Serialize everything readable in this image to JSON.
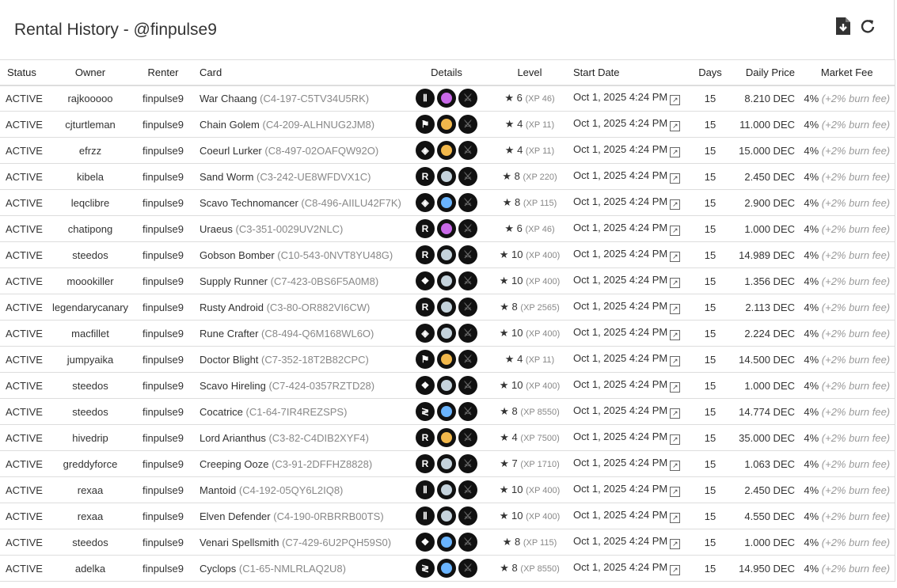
{
  "header": {
    "title": "Rental History - @finpulse9",
    "download_icon": "file-download-icon",
    "refresh_icon": "refresh-icon"
  },
  "columns": [
    "Status",
    "Owner",
    "Renter",
    "Card",
    "Details",
    "Level",
    "Start Date",
    "Days",
    "Daily Price",
    "Market Fee"
  ],
  "rarity_colors": {
    "common": "#c5d3dc",
    "rare": "#6ab4ff",
    "epic": "#c969e8",
    "legendary": "#f2b84b"
  },
  "rows": [
    {
      "status": "ACTIVE",
      "owner": "rajkooooo",
      "renter": "finpulse9",
      "card": "War Chaang",
      "uid": "(C4-197-C5TV34U5RK)",
      "edition": "Ⅱ",
      "rarity": "epic",
      "level": "6",
      "xp": "(XP 46)",
      "date": "Oct 1, 2025 4:24 PM",
      "days": "15",
      "price": "8.210 DEC",
      "fee": "4%",
      "burn": "(+2% burn fee)"
    },
    {
      "status": "ACTIVE",
      "owner": "cjturtleman",
      "renter": "finpulse9",
      "card": "Chain Golem",
      "uid": "(C4-209-ALHNUG2JM8)",
      "edition": "⚑",
      "rarity": "legendary",
      "level": "4",
      "xp": "(XP 11)",
      "date": "Oct 1, 2025 4:24 PM",
      "days": "15",
      "price": "11.000 DEC",
      "fee": "4%",
      "burn": "(+2% burn fee)"
    },
    {
      "status": "ACTIVE",
      "owner": "efrzz",
      "renter": "finpulse9",
      "card": "Coeurl Lurker",
      "uid": "(C8-497-02OAFQW92O)",
      "edition": "◈",
      "rarity": "legendary",
      "level": "4",
      "xp": "(XP 11)",
      "date": "Oct 1, 2025 4:24 PM",
      "days": "15",
      "price": "15.000 DEC",
      "fee": "4%",
      "burn": "(+2% burn fee)"
    },
    {
      "status": "ACTIVE",
      "owner": "kibela",
      "renter": "finpulse9",
      "card": "Sand Worm",
      "uid": "(C3-242-UE8WFDVX1C)",
      "edition": "R",
      "rarity": "common",
      "level": "8",
      "xp": "(XP 220)",
      "date": "Oct 1, 2025 4:24 PM",
      "days": "15",
      "price": "2.450 DEC",
      "fee": "4%",
      "burn": "(+2% burn fee)"
    },
    {
      "status": "ACTIVE",
      "owner": "leqclibre",
      "renter": "finpulse9",
      "card": "Scavo Technomancer",
      "uid": "(C8-496-AIILU42F7K)",
      "edition": "◈",
      "rarity": "rare",
      "level": "8",
      "xp": "(XP 115)",
      "date": "Oct 1, 2025 4:24 PM",
      "days": "15",
      "price": "2.900 DEC",
      "fee": "4%",
      "burn": "(+2% burn fee)"
    },
    {
      "status": "ACTIVE",
      "owner": "chatipong",
      "renter": "finpulse9",
      "card": "Uraeus",
      "uid": "(C3-351-0029UV2NLC)",
      "edition": "R",
      "rarity": "epic",
      "level": "6",
      "xp": "(XP 46)",
      "date": "Oct 1, 2025 4:24 PM",
      "days": "15",
      "price": "1.000 DEC",
      "fee": "4%",
      "burn": "(+2% burn fee)"
    },
    {
      "status": "ACTIVE",
      "owner": "steedos",
      "renter": "finpulse9",
      "card": "Gobson Bomber",
      "uid": "(C10-543-0NVT8YU48G)",
      "edition": "R",
      "rarity": "common",
      "level": "10",
      "xp": "(XP 400)",
      "date": "Oct 1, 2025 4:24 PM",
      "days": "15",
      "price": "14.989 DEC",
      "fee": "4%",
      "burn": "(+2% burn fee)"
    },
    {
      "status": "ACTIVE",
      "owner": "moookiller",
      "renter": "finpulse9",
      "card": "Supply Runner",
      "uid": "(C7-423-0BS6F5A0M8)",
      "edition": "❖",
      "rarity": "common",
      "level": "10",
      "xp": "(XP 400)",
      "date": "Oct 1, 2025 4:24 PM",
      "days": "15",
      "price": "1.356 DEC",
      "fee": "4%",
      "burn": "(+2% burn fee)"
    },
    {
      "status": "ACTIVE",
      "owner": "legendarycanary",
      "renter": "finpulse9",
      "card": "Rusty Android",
      "uid": "(C3-80-OR882VI6CW)",
      "edition": "R",
      "rarity": "common",
      "level": "8",
      "xp": "(XP 2565)",
      "date": "Oct 1, 2025 4:24 PM",
      "days": "15",
      "price": "2.113 DEC",
      "fee": "4%",
      "burn": "(+2% burn fee)"
    },
    {
      "status": "ACTIVE",
      "owner": "macfillet",
      "renter": "finpulse9",
      "card": "Rune Crafter",
      "uid": "(C8-494-Q6M168WL6O)",
      "edition": "◈",
      "rarity": "common",
      "level": "10",
      "xp": "(XP 400)",
      "date": "Oct 1, 2025 4:24 PM",
      "days": "15",
      "price": "2.224 DEC",
      "fee": "4%",
      "burn": "(+2% burn fee)"
    },
    {
      "status": "ACTIVE",
      "owner": "jumpyaika",
      "renter": "finpulse9",
      "card": "Doctor Blight",
      "uid": "(C7-352-18T2B82CPC)",
      "edition": "⚑",
      "rarity": "legendary",
      "level": "4",
      "xp": "(XP 11)",
      "date": "Oct 1, 2025 4:24 PM",
      "days": "15",
      "price": "14.500 DEC",
      "fee": "4%",
      "burn": "(+2% burn fee)"
    },
    {
      "status": "ACTIVE",
      "owner": "steedos",
      "renter": "finpulse9",
      "card": "Scavo Hireling",
      "uid": "(C7-424-0357RZTD28)",
      "edition": "❖",
      "rarity": "common",
      "level": "10",
      "xp": "(XP 400)",
      "date": "Oct 1, 2025 4:24 PM",
      "days": "15",
      "price": "1.000 DEC",
      "fee": "4%",
      "burn": "(+2% burn fee)"
    },
    {
      "status": "ACTIVE",
      "owner": "steedos",
      "renter": "finpulse9",
      "card": "Cocatrice",
      "uid": "(C1-64-7IR4REZSPS)",
      "edition": "≷",
      "rarity": "rare",
      "level": "8",
      "xp": "(XP 8550)",
      "date": "Oct 1, 2025 4:24 PM",
      "days": "15",
      "price": "14.774 DEC",
      "fee": "4%",
      "burn": "(+2% burn fee)"
    },
    {
      "status": "ACTIVE",
      "owner": "hivedrip",
      "renter": "finpulse9",
      "card": "Lord Arianthus",
      "uid": "(C3-82-C4DIB2XYF4)",
      "edition": "R",
      "rarity": "legendary",
      "level": "4",
      "xp": "(XP 7500)",
      "date": "Oct 1, 2025 4:24 PM",
      "days": "15",
      "price": "35.000 DEC",
      "fee": "4%",
      "burn": "(+2% burn fee)"
    },
    {
      "status": "ACTIVE",
      "owner": "greddyforce",
      "renter": "finpulse9",
      "card": "Creeping Ooze",
      "uid": "(C3-91-2DFFHZ8828)",
      "edition": "R",
      "rarity": "common",
      "level": "7",
      "xp": "(XP 1710)",
      "date": "Oct 1, 2025 4:24 PM",
      "days": "15",
      "price": "1.063 DEC",
      "fee": "4%",
      "burn": "(+2% burn fee)"
    },
    {
      "status": "ACTIVE",
      "owner": "rexaa",
      "renter": "finpulse9",
      "card": "Mantoid",
      "uid": "(C4-192-05QY6L2IQ8)",
      "edition": "Ⅱ",
      "rarity": "common",
      "level": "10",
      "xp": "(XP 400)",
      "date": "Oct 1, 2025 4:24 PM",
      "days": "15",
      "price": "2.450 DEC",
      "fee": "4%",
      "burn": "(+2% burn fee)"
    },
    {
      "status": "ACTIVE",
      "owner": "rexaa",
      "renter": "finpulse9",
      "card": "Elven Defender",
      "uid": "(C4-190-0RBRRB00TS)",
      "edition": "Ⅱ",
      "rarity": "common",
      "level": "10",
      "xp": "(XP 400)",
      "date": "Oct 1, 2025 4:24 PM",
      "days": "15",
      "price": "4.550 DEC",
      "fee": "4%",
      "burn": "(+2% burn fee)"
    },
    {
      "status": "ACTIVE",
      "owner": "steedos",
      "renter": "finpulse9",
      "card": "Venari Spellsmith",
      "uid": "(C7-429-6U2PQH59S0)",
      "edition": "❖",
      "rarity": "rare",
      "level": "8",
      "xp": "(XP 115)",
      "date": "Oct 1, 2025 4:24 PM",
      "days": "15",
      "price": "1.000 DEC",
      "fee": "4%",
      "burn": "(+2% burn fee)"
    },
    {
      "status": "ACTIVE",
      "owner": "adelka",
      "renter": "finpulse9",
      "card": "Cyclops",
      "uid": "(C1-65-NMLRLAQ2U8)",
      "edition": "≷",
      "rarity": "rare",
      "level": "8",
      "xp": "(XP 8550)",
      "date": "Oct 1, 2025 4:24 PM",
      "days": "15",
      "price": "14.950 DEC",
      "fee": "4%",
      "burn": "(+2% burn fee)"
    }
  ]
}
